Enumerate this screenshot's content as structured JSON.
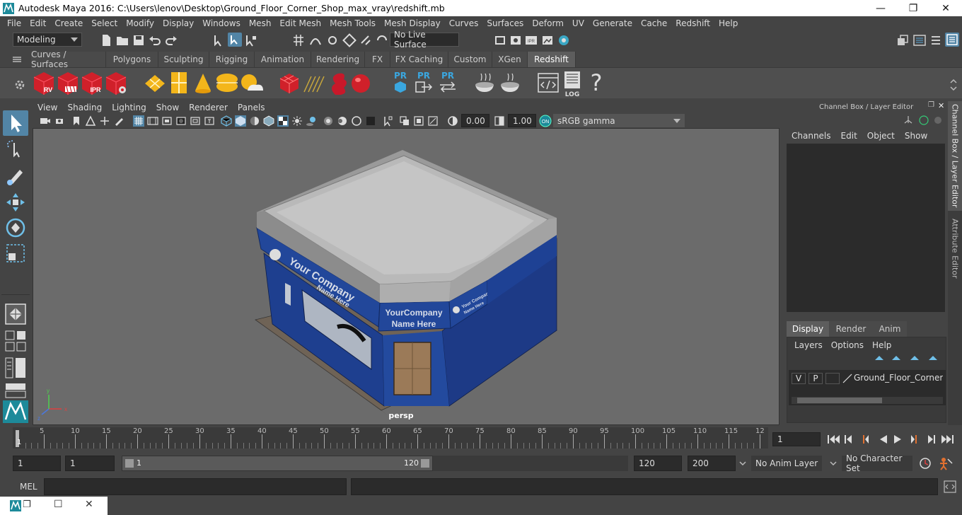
{
  "window": {
    "title": "Autodesk Maya 2016: C:\\Users\\lenov\\Desktop\\Ground_Floor_Corner_Shop_max_vray\\redshift.mb",
    "minimize": "—",
    "maximize": "❐",
    "close": "✕"
  },
  "menu": [
    "File",
    "Edit",
    "Create",
    "Select",
    "Modify",
    "Display",
    "Windows",
    "Mesh",
    "Edit Mesh",
    "Mesh Tools",
    "Mesh Display",
    "Curves",
    "Surfaces",
    "Deform",
    "UV",
    "Generate",
    "Cache",
    "Redshift",
    "Help"
  ],
  "status": {
    "mode": "Modeling",
    "live_surface": "No Live Surface"
  },
  "shelf_tabs": [
    "Curves / Surfaces",
    "Polygons",
    "Sculpting",
    "Rigging",
    "Animation",
    "Rendering",
    "FX",
    "FX Caching",
    "Custom",
    "XGen",
    "Redshift"
  ],
  "shelf_active": "Redshift",
  "shelf_icons": {
    "rv": "RV",
    "ipr": "IPR",
    "pr": "PR",
    "log": "LOG",
    "help": "?"
  },
  "viewport": {
    "menu": [
      "View",
      "Shading",
      "Lighting",
      "Show",
      "Renderer",
      "Panels"
    ],
    "exposure": "0.00",
    "gamma": "1.00",
    "color_space": "sRGB gamma",
    "camera": "persp",
    "sign_main_line1": "YourCompany",
    "sign_main_line2": "Name Here",
    "sign_side_line1": "Your Company",
    "sign_side_line2": "Name Here",
    "sign_right_line1": "Your Company",
    "sign_right_line2": "Name Here"
  },
  "channel_box": {
    "title": "Channel Box / Layer Editor",
    "menu": [
      "Channels",
      "Edit",
      "Object",
      "Show"
    ]
  },
  "layer_editor": {
    "tabs": [
      "Display",
      "Render",
      "Anim"
    ],
    "active_tab": "Display",
    "menu": [
      "Layers",
      "Options",
      "Help"
    ],
    "layer": {
      "v": "V",
      "p": "P",
      "name": "Ground_Floor_Corner_Sh"
    }
  },
  "side_tabs": [
    "Channel Box / Layer Editor",
    "Attribute Editor"
  ],
  "timeline": {
    "ticks": [
      "5",
      "10",
      "15",
      "20",
      "25",
      "30",
      "35",
      "40",
      "45",
      "50",
      "55",
      "60",
      "65",
      "70",
      "75",
      "80",
      "85",
      "90",
      "95",
      "100",
      "105",
      "110",
      "115",
      "12"
    ],
    "current_frame_marker": "1",
    "current_frame": "1"
  },
  "range": {
    "start": "1",
    "playback_start": "1",
    "slider_start": "1",
    "slider_end": "120",
    "playback_end": "120",
    "end": "200",
    "anim_layer": "No Anim Layer",
    "char_set": "No Character Set"
  },
  "command": {
    "label": "MEL"
  },
  "colors": {
    "accent_blue": "#5285a6",
    "shop_blue": "#1e3f8f",
    "redshift_red": "#d0202a"
  }
}
